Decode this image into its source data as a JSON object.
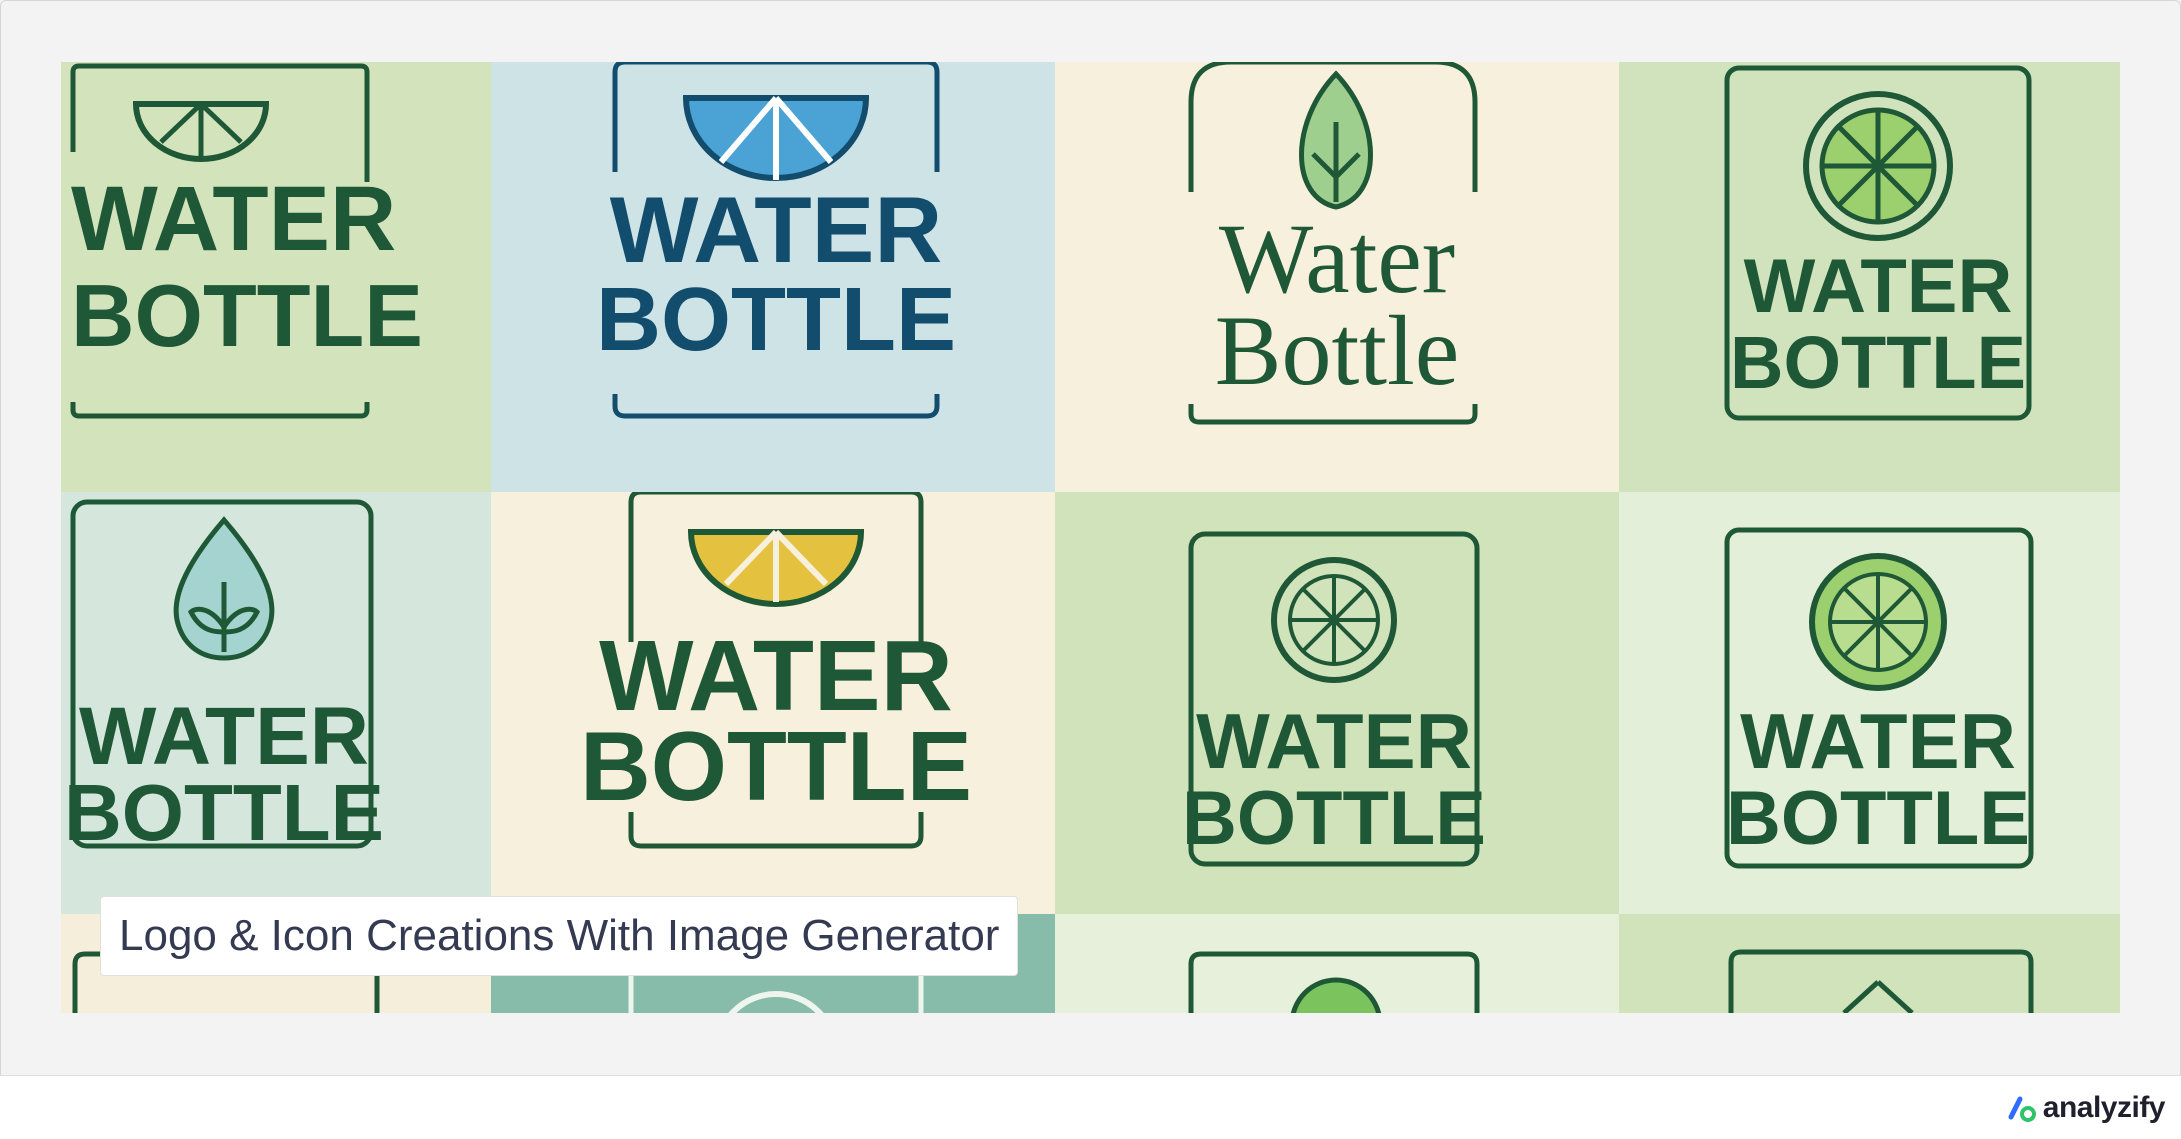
{
  "caption": {
    "text": "Logo & Icon Creations With Image Generator"
  },
  "brand": {
    "name": "analyzify",
    "logo_icon": "analyzify-logo-icon"
  },
  "logo_tiles": [
    {
      "line1": "WATER",
      "line2": "BOTTLE",
      "icon": "lime-slice-icon",
      "bg": "#d3e4bd"
    },
    {
      "line1": "WATER",
      "line2": "BOTTLE",
      "icon": "blue-citrus-slice-icon",
      "bg": "#cde3e6"
    },
    {
      "line1": "Water",
      "line2": "Bottle",
      "icon": "leaf-icon",
      "bg": "#f6f0dd"
    },
    {
      "line1": "WATER",
      "line2": "BOTTLE",
      "icon": "citrus-wheel-icon",
      "bg": "#d1e3bd"
    },
    {
      "line1": "WATER",
      "line2": "BOTTLE",
      "icon": "drop-sprout-icon",
      "bg": "#d5e7dd"
    },
    {
      "line1": "WATER",
      "line2": "BOTTLE",
      "icon": "yellow-lemon-slice-icon",
      "bg": "#f7f0dc"
    },
    {
      "line1": "WATER",
      "line2": "BOTTLE",
      "icon": "citrus-wheel-icon",
      "bg": "#d0e3bb"
    },
    {
      "line1": "WATER",
      "line2": "BOTTLE",
      "icon": "lime-wheel-icon",
      "bg": "#e4efd9"
    }
  ],
  "colors": {
    "dark_green": "#1f5836",
    "navy_blue": "#134d6d",
    "lime_fill": "#9ccf6e",
    "lemon_fill": "#e4c13e",
    "blue_fill": "#4aa3d4"
  }
}
